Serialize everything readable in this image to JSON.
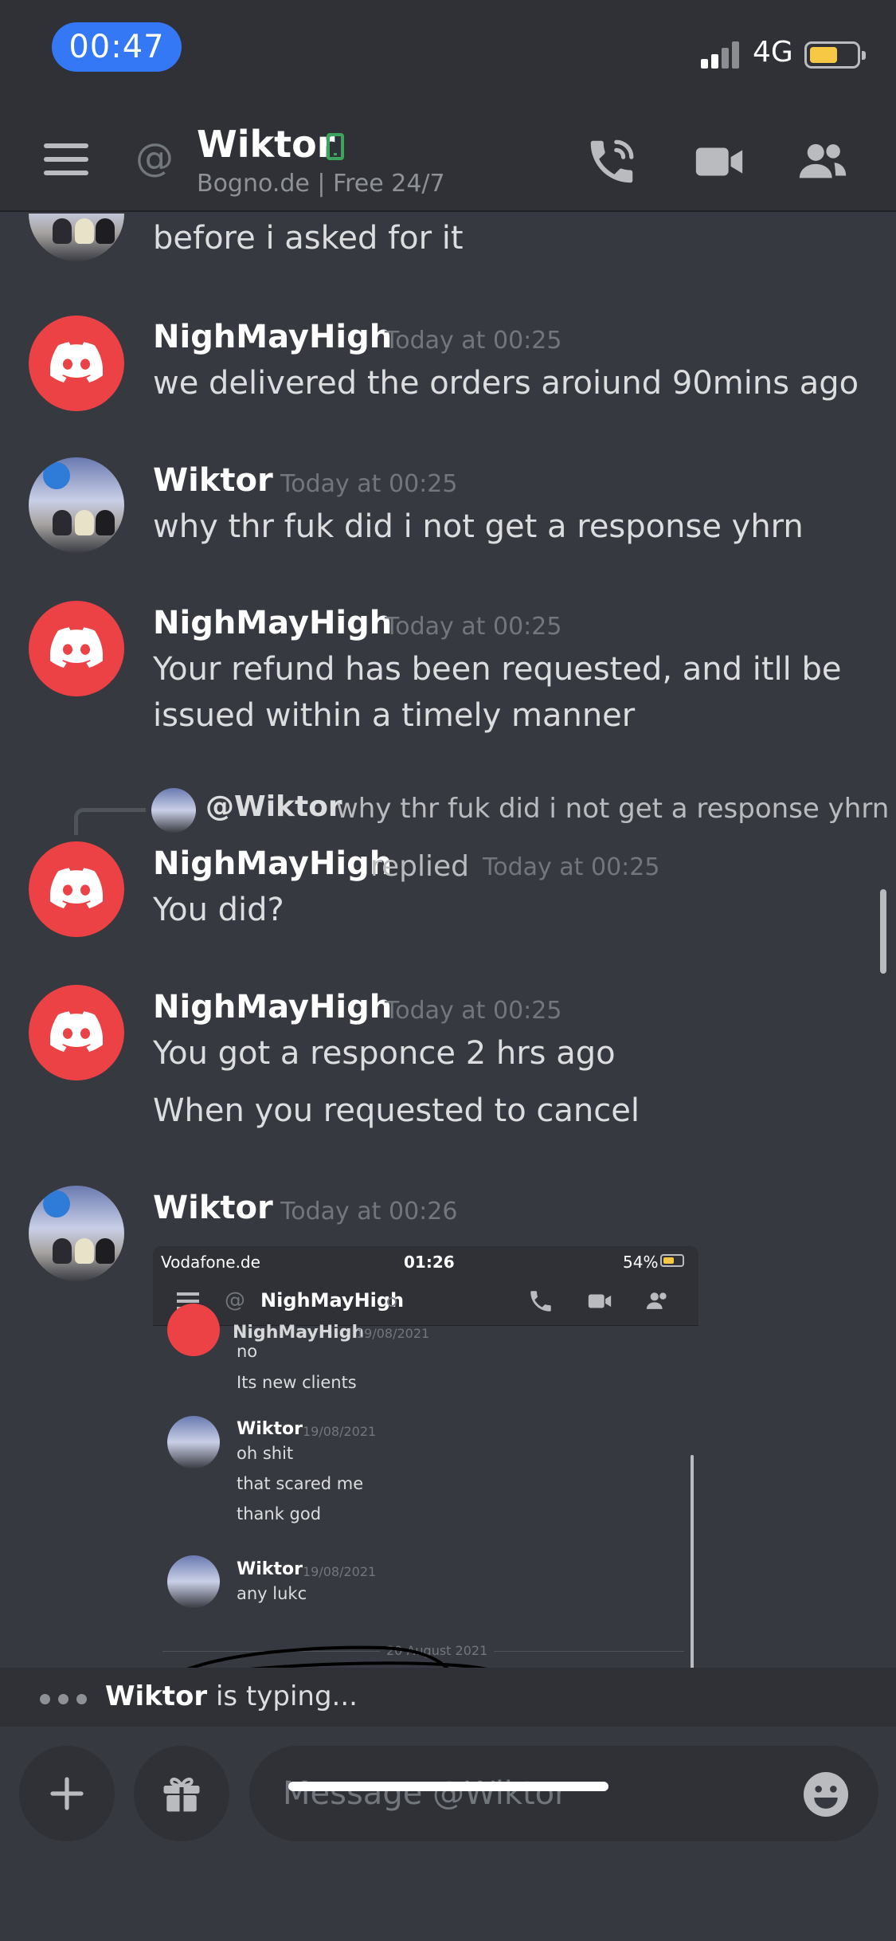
{
  "status_bar": {
    "time": "00:47",
    "network": "4G"
  },
  "header": {
    "at_symbol": "@",
    "title": "Wiktor",
    "subtitle": "Bogno.de  | Free 24/7"
  },
  "messages": [
    {
      "author": "",
      "text": "before i asked for it"
    },
    {
      "author": "NighMayHigh",
      "timestamp": "Today at 00:25",
      "text": "we delivered the orders aroiund 90mins ago"
    },
    {
      "author": "Wiktor",
      "timestamp": "Today at 00:25",
      "text": "why thr fuk did i not get a response yhrn"
    },
    {
      "author": "NighMayHigh",
      "timestamp": "Today at 00:25",
      "lines": [
        "Your refund has been requested, and itll be",
        "issued within a timely manner"
      ]
    },
    {
      "reply_to": {
        "mention": "@Wiktor",
        "text": "why thr fuk did i not get a response yhrn"
      },
      "author": "NighMayHigh",
      "replied_label": "replied",
      "timestamp": "Today at 00:25",
      "text": "You did?"
    },
    {
      "author": "NighMayHigh",
      "timestamp": "Today at 00:25",
      "lines": [
        "You got a responce 2 hrs ago",
        "When you requested to cancel"
      ]
    },
    {
      "author": "Wiktor",
      "timestamp": "Today at 00:26"
    }
  ],
  "attachment": {
    "status_carrier": "Vodafone.de",
    "status_time": "01:26",
    "status_battery": "54%",
    "header_title": "NighMayHigh",
    "partial_author": "NighMayHigh",
    "partial_date": "19/08/2021",
    "partial_lines": [
      "no",
      "Its new clients"
    ],
    "msg1": {
      "author": "Wiktor",
      "date": "19/08/2021",
      "lines": [
        "oh shit",
        "that scared me",
        "thank god"
      ]
    },
    "msg2": {
      "author": "Wiktor",
      "date": "19/08/2021",
      "lines": [
        "any lukc"
      ]
    },
    "divider": "20 August 2021"
  },
  "typing": {
    "user": "Wiktor",
    "text": " is typing..."
  },
  "composer": {
    "placeholder": "Message @Wiktor"
  },
  "colors": {
    "background": "#36393f",
    "header": "#2f3136",
    "brand_red": "#ed4245",
    "online_green": "#3ba55d",
    "status_blue": "#3478f6"
  },
  "icons": [
    "hamburger-icon",
    "at-icon",
    "mobile-icon",
    "phone-call-icon",
    "video-camera-icon",
    "members-icon",
    "discord-logo-icon",
    "chevron-down-icon",
    "plus-icon",
    "gift-icon",
    "emoji-icon"
  ]
}
